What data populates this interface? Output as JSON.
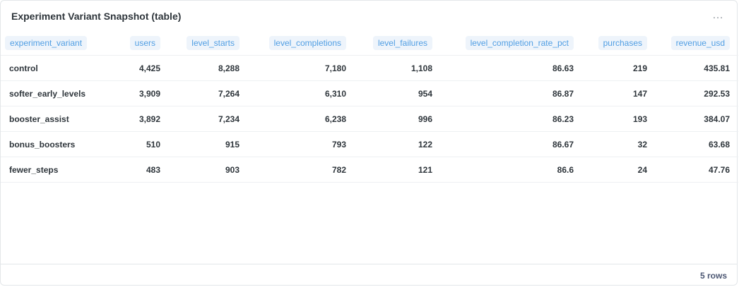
{
  "card": {
    "title": "Experiment Variant Snapshot (table)",
    "more_icon": "…"
  },
  "table": {
    "columns": [
      {
        "label": "experiment_variant",
        "align": "left"
      },
      {
        "label": "users",
        "align": "right"
      },
      {
        "label": "level_starts",
        "align": "right"
      },
      {
        "label": "level_completions",
        "align": "right"
      },
      {
        "label": "level_failures",
        "align": "right"
      },
      {
        "label": "level_completion_rate_pct",
        "align": "right"
      },
      {
        "label": "purchases",
        "align": "right"
      },
      {
        "label": "revenue_usd",
        "align": "right"
      }
    ],
    "rows": [
      [
        "control",
        "4,425",
        "8,288",
        "7,180",
        "1,108",
        "86.63",
        "219",
        "435.81"
      ],
      [
        "softer_early_levels",
        "3,909",
        "7,264",
        "6,310",
        "954",
        "86.87",
        "147",
        "292.53"
      ],
      [
        "booster_assist",
        "3,892",
        "7,234",
        "6,238",
        "996",
        "86.23",
        "193",
        "384.07"
      ],
      [
        "bonus_boosters",
        "510",
        "915",
        "793",
        "122",
        "86.67",
        "32",
        "63.68"
      ],
      [
        "fewer_steps",
        "483",
        "903",
        "782",
        "121",
        "86.6",
        "24",
        "47.76"
      ]
    ]
  },
  "footer": {
    "row_count": "5 rows"
  },
  "colors": {
    "accent": "#509ee3",
    "pill_bg": "#eef4fb",
    "text": "#2e353b",
    "border": "#e3e6e9"
  }
}
